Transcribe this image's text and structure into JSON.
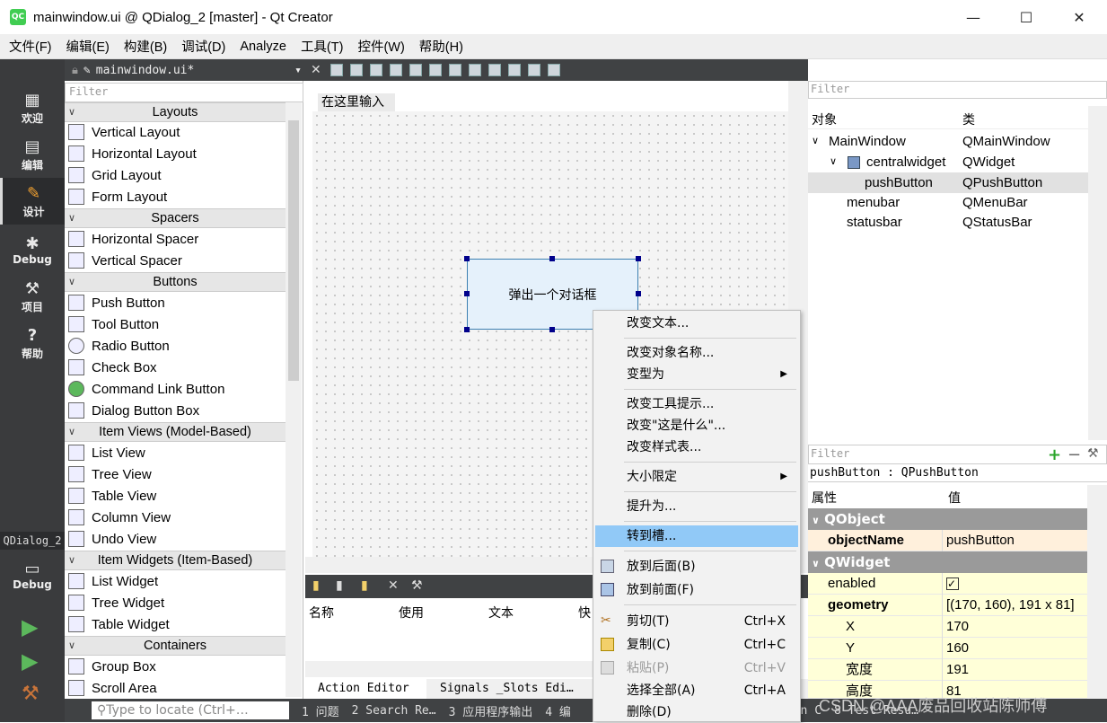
{
  "window": {
    "title": "mainwindow.ui @ QDialog_2 [master] - Qt Creator",
    "app_icon": "QC",
    "minimize": "—",
    "maximize": "☐",
    "close": "✕"
  },
  "menubar": [
    "文件(F)",
    "编辑(E)",
    "构建(B)",
    "调试(D)",
    "Analyze",
    "工具(T)",
    "控件(W)",
    "帮助(H)"
  ],
  "modes": [
    {
      "label": "欢迎",
      "icon": "grid-icon"
    },
    {
      "label": "编辑",
      "icon": "document-icon"
    },
    {
      "label": "设计",
      "icon": "pencil-icon"
    },
    {
      "label": "Debug",
      "icon": "bug-icon"
    },
    {
      "label": "项目",
      "icon": "wrench-icon"
    },
    {
      "label": "帮助",
      "icon": "help-icon"
    }
  ],
  "kit": {
    "project": "QDialog_2",
    "label": "Debug"
  },
  "doc": {
    "filename": "mainwindow.ui*"
  },
  "widgetbox": {
    "filter_placeholder": "Filter",
    "layouts": {
      "title": "Layouts",
      "items": [
        "Vertical Layout",
        "Horizontal Layout",
        "Grid Layout",
        "Form Layout"
      ]
    },
    "spacers": {
      "title": "Spacers",
      "items": [
        "Horizontal Spacer",
        "Vertical Spacer"
      ]
    },
    "buttons": {
      "title": "Buttons",
      "items": [
        "Push Button",
        "Tool Button",
        "Radio Button",
        "Check Box",
        "Command Link Button",
        "Dialog Button Box"
      ]
    },
    "itemviews": {
      "title": "Item Views (Model-Based)",
      "items": [
        "List View",
        "Tree View",
        "Table View",
        "Column View",
        "Undo View"
      ]
    },
    "itemwidgets": {
      "title": "Item Widgets (Item-Based)",
      "items": [
        "List Widget",
        "Tree Widget",
        "Table Widget"
      ]
    },
    "containers": {
      "title": "Containers",
      "items": [
        "Group Box",
        "Scroll Area"
      ]
    }
  },
  "form": {
    "menu_placeholder": "在这里输入",
    "button_text": "弹出一个对话框"
  },
  "action_editor": {
    "columns": [
      "名称",
      "使用",
      "文本",
      "快"
    ],
    "tabs": [
      "Action Editor",
      "Signals _Slots Edi…"
    ]
  },
  "object_inspector": {
    "filter_placeholder": "Filter",
    "headers": [
      "对象",
      "类"
    ],
    "rows": [
      {
        "name": "MainWindow",
        "class": "QMainWindow"
      },
      {
        "name": "centralwidget",
        "class": "QWidget"
      },
      {
        "name": "pushButton",
        "class": "QPushButton"
      },
      {
        "name": "menubar",
        "class": "QMenuBar"
      },
      {
        "name": "statusbar",
        "class": "QStatusBar"
      }
    ]
  },
  "property_editor": {
    "filter_placeholder": "Filter",
    "class_line": "pushButton : QPushButton",
    "headers": [
      "属性",
      "值"
    ],
    "groups": [
      "QObject",
      "QWidget"
    ],
    "props": [
      {
        "key": "objectName",
        "value": "pushButton"
      },
      {
        "key": "enabled",
        "value": "✓"
      },
      {
        "key": "geometry",
        "value": "[(170, 160), 191 x 81]"
      },
      {
        "key": "X",
        "value": "170"
      },
      {
        "key": "Y",
        "value": "160"
      },
      {
        "key": "宽度",
        "value": "191"
      },
      {
        "key": "高度",
        "value": "81"
      }
    ]
  },
  "context_menu": {
    "items": [
      {
        "label": "改变文本..."
      },
      {
        "label": "改变对象名称..."
      },
      {
        "label": "变型为",
        "arrow": "▶"
      },
      {
        "label": "改变工具提示..."
      },
      {
        "label": "改变\"这是什么\"..."
      },
      {
        "label": "改变样式表..."
      },
      {
        "label": "大小限定",
        "arrow": "▶"
      },
      {
        "label": "提升为..."
      },
      {
        "label": "转到槽..."
      },
      {
        "label": "放到后面(B)"
      },
      {
        "label": "放到前面(F)"
      },
      {
        "label": "剪切(T)",
        "shortcut": "Ctrl+X"
      },
      {
        "label": "复制(C)",
        "shortcut": "Ctrl+C"
      },
      {
        "label": "粘贴(P)",
        "shortcut": "Ctrl+V"
      },
      {
        "label": "选择全部(A)",
        "shortcut": "Ctrl+A"
      },
      {
        "label": "删除(D)"
      }
    ]
  },
  "statusbar": {
    "locator_placeholder": "Type to locate (Ctrl+…",
    "tabs": [
      "1 问题",
      "2 Search Re…",
      "3 应用程序输出",
      "4 编",
      "ion C",
      "8 Test Resu…"
    ]
  },
  "watermark": "CSDN @AAA废品回收站陈师傅"
}
